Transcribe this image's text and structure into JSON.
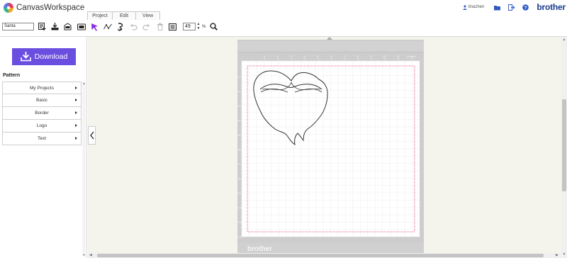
{
  "app": {
    "name": "CanvasWorkspace",
    "brand": "brother"
  },
  "menu": {
    "tabs": [
      {
        "label": "Project"
      },
      {
        "label": "Edit"
      },
      {
        "label": "View"
      }
    ]
  },
  "user": {
    "name": "tinazhen"
  },
  "toolbar": {
    "search_value": "Santa",
    "zoom_value": "49",
    "zoom_unit": "%"
  },
  "sidebar": {
    "download_label": "Download",
    "pattern_title": "Pattern",
    "categories": [
      {
        "label": "My Projects"
      },
      {
        "label": "Basic"
      },
      {
        "label": "Border"
      },
      {
        "label": "Logo"
      },
      {
        "label": "Text"
      }
    ]
  },
  "mat": {
    "brand": "brother",
    "top_ruler": [
      "1",
      "2",
      "3",
      "4",
      "5",
      "6",
      "7",
      "8",
      "9",
      "10",
      "11",
      "12 inch"
    ],
    "side_ruler": [
      "1",
      "2",
      "3",
      "4",
      "5",
      "6",
      "7",
      "8",
      "9",
      "10",
      "11",
      "12"
    ]
  },
  "colors": {
    "accent": "#6a4ee0",
    "cursor_tool": "#8a2be2",
    "brand_blue": "#1a3b8c",
    "cut_line": "#e0305a",
    "mat_gray": "#cdcdcd",
    "workspace_bg": "#f4f3ec"
  },
  "icons": {
    "toolbar": [
      "new-project-icon",
      "import-icon",
      "save-icon",
      "convert-icon",
      "select-tool-icon",
      "node-tool-icon",
      "welding-icon",
      "undo-icon",
      "redo-icon",
      "delete-icon",
      "list-icon",
      "zoom-icon"
    ]
  }
}
